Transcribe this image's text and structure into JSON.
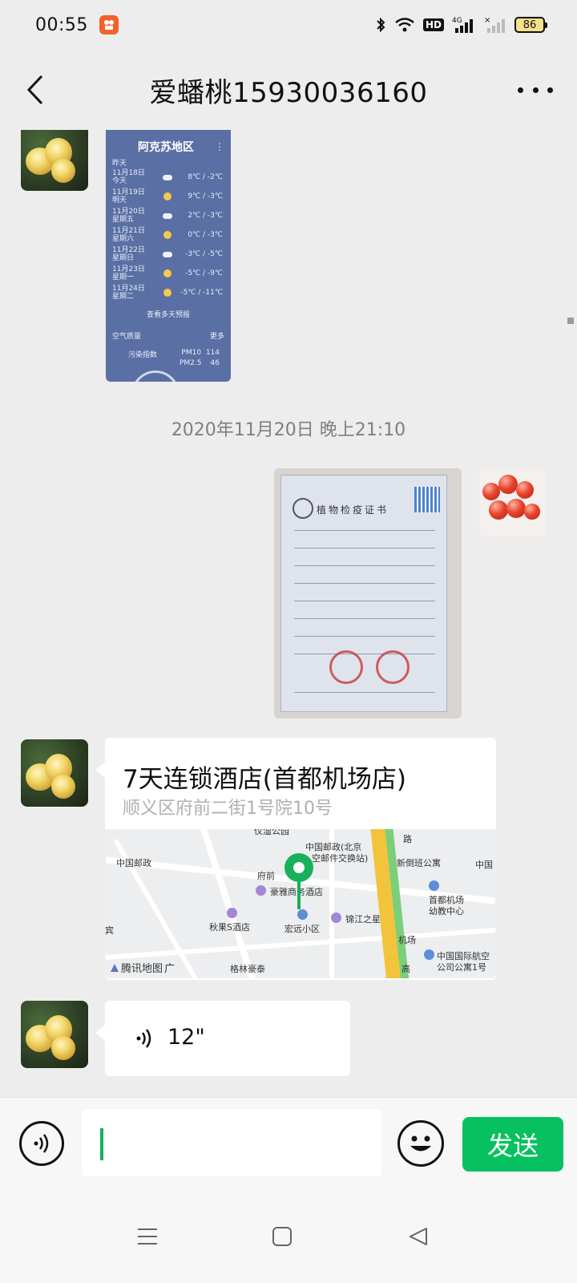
{
  "status_bar": {
    "time": "00:55",
    "hd_label": "HD",
    "network": "4G",
    "battery": "86"
  },
  "header": {
    "title": "爱蟠桃15930036160"
  },
  "weather_card": {
    "region": "阿克苏地区",
    "header_label": "昨天",
    "rows": [
      {
        "date": "11月18日",
        "day": "今天",
        "icon": "cloud",
        "temp": "8℃ / -2℃"
      },
      {
        "date": "11月19日",
        "day": "明天",
        "icon": "sun",
        "temp": "9℃ / -3℃"
      },
      {
        "date": "11月20日",
        "day": "星期五",
        "icon": "cloud",
        "temp": "2℃ / -3℃"
      },
      {
        "date": "11月21日",
        "day": "星期六",
        "icon": "sun",
        "temp": "0℃ / -3℃"
      },
      {
        "date": "11月22日",
        "day": "星期日",
        "icon": "cloud-sun",
        "temp": "-3℃ / -5℃"
      },
      {
        "date": "11月23日",
        "day": "星期一",
        "icon": "sun",
        "temp": "-5℃ / -9℃"
      },
      {
        "date": "11月24日",
        "day": "星期二",
        "icon": "sun",
        "temp": "-5℃ / -11℃"
      }
    ],
    "more_forecast": "查看多天预报",
    "air_quality": "空气质量",
    "more": "更多",
    "pollution_index": "污染指数",
    "pm10_label": "PM10",
    "pm10_value": "114",
    "pm25_label": "PM2.5",
    "pm25_value": "46"
  },
  "timestamp": "2020年11月20日 晚上21:10",
  "certificate": {
    "title": "植物检疫证书"
  },
  "location": {
    "name": "7天连锁酒店(首都机场店)",
    "address": "顺义区府前二街1号院10号",
    "map_labels": {
      "top_road": "仪湿公园",
      "post_office_left": "中国邮政",
      "post_office_beijing": "中国邮政(北京",
      "exchange_station": "空邮件交换站)",
      "road_label": "路",
      "xinjiaban": "新倒班公寓",
      "china_right": "中国",
      "fuqian": "府前",
      "haoya": "豪雅商务酒店",
      "airport_kinder": "首都机场",
      "kinder": "幼教中心",
      "qiuguo": "秋果S酒店",
      "hongyuan": "宏远小区",
      "jinjiang": "锦江之星",
      "jichang": "机场",
      "gao": "高",
      "intl_aviation": "中国国际航空",
      "apartment": "公司公寓1号",
      "linhaotai": "格林豪泰",
      "map_brand": "腾讯地图",
      "guang": "广",
      "hotel_left": "宾"
    }
  },
  "voice_message": {
    "duration": "12\""
  },
  "input_bar": {
    "text_value": "",
    "send_label": "发送"
  }
}
